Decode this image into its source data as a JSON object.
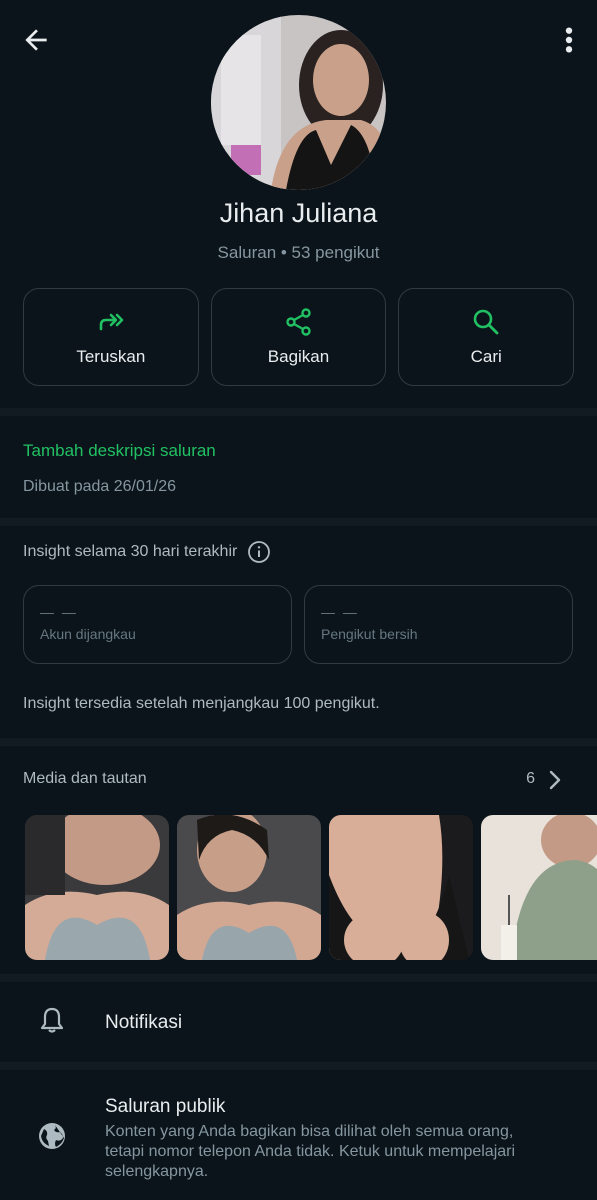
{
  "channel": {
    "name": "Jihan Juliana",
    "subtitle": "Saluran • 53 pengikut"
  },
  "actions": [
    {
      "label": "Teruskan",
      "icon": "forward-icon"
    },
    {
      "label": "Bagikan",
      "icon": "share-icon"
    },
    {
      "label": "Cari",
      "icon": "search-icon"
    }
  ],
  "description": {
    "add_label": "Tambah deskripsi saluran",
    "created": "Dibuat pada 26/01/26"
  },
  "insights": {
    "title": "Insight selama 30 hari terakhir",
    "stats": [
      {
        "value": "— —",
        "label": "Akun dijangkau"
      },
      {
        "value": "— —",
        "label": "Pengikut bersih"
      }
    ],
    "note": "Insight tersedia setelah menjangkau 100 pengikut."
  },
  "media": {
    "title": "Media dan tautan",
    "count": "6"
  },
  "settings": {
    "notifications": "Notifikasi",
    "public_title": "Saluran publik",
    "public_desc": "Konten yang Anda bagikan bisa dilihat oleh semua orang, tetapi nomor telepon Anda tidak. Ketuk untuk mempelajari selengkapnya."
  },
  "colors": {
    "background": "#0b141a",
    "accent": "#21c063",
    "muted": "#8696a0",
    "border": "#2f3b43"
  }
}
